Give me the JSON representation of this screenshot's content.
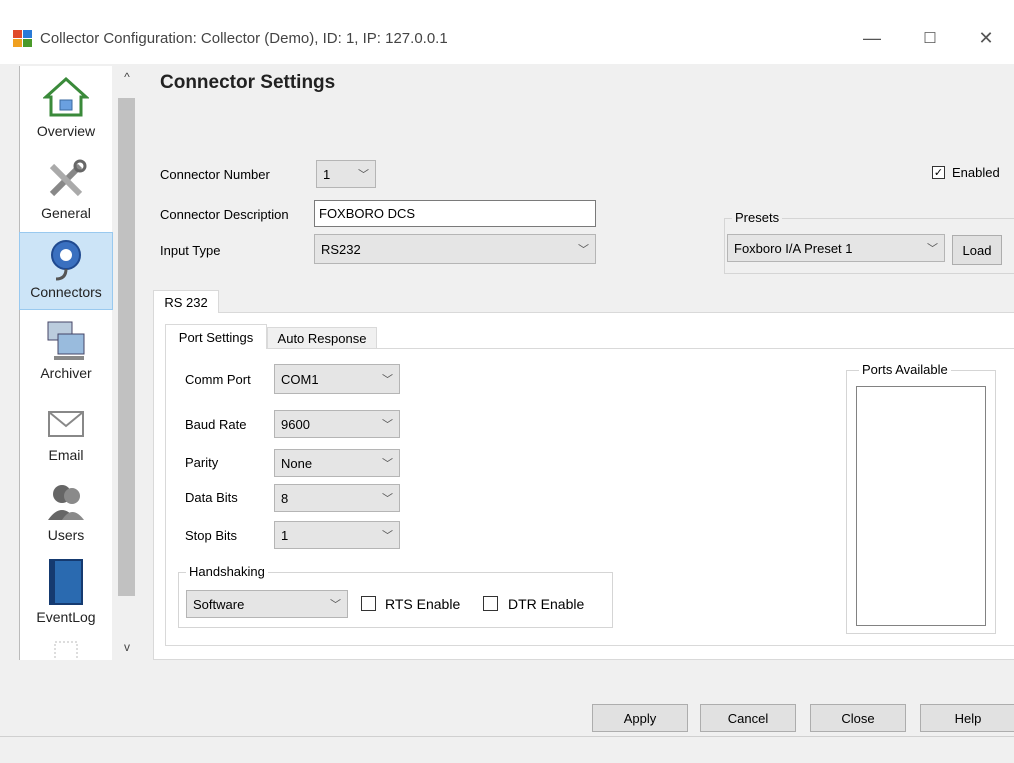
{
  "window": {
    "title": "Collector Configuration: Collector (Demo), ID: 1, IP: 127.0.0.1",
    "minimize": "—",
    "maximize": "☐",
    "close": "✕"
  },
  "nav": {
    "items": [
      {
        "label": "Overview"
      },
      {
        "label": "General"
      },
      {
        "label": "Connectors"
      },
      {
        "label": "Archiver"
      },
      {
        "label": "Email"
      },
      {
        "label": "Users"
      },
      {
        "label": "EventLog"
      }
    ],
    "scroll_up": "^",
    "scroll_down": "v"
  },
  "page_title": "Connector Settings",
  "connector": {
    "number_label": "Connector Number",
    "number_value": "1",
    "description_label": "Connector Description",
    "description_value": "FOXBORO DCS",
    "input_type_label": "Input Type",
    "input_type_value": "RS232",
    "enabled_label": "Enabled",
    "enabled_checked": true
  },
  "presets": {
    "legend": "Presets",
    "value": "Foxboro I/A Preset 1",
    "load_label": "Load"
  },
  "outer_tab": {
    "label": "RS 232"
  },
  "inner_tabs": [
    {
      "label": "Port Settings",
      "active": true
    },
    {
      "label": "Auto Response",
      "active": false
    }
  ],
  "port": {
    "comm_port_label": "Comm Port",
    "comm_port_value": "COM1",
    "baud_label": "Baud Rate",
    "baud_value": "9600",
    "parity_label": "Parity",
    "parity_value": "None",
    "data_bits_label": "Data Bits",
    "data_bits_value": "8",
    "stop_bits_label": "Stop Bits",
    "stop_bits_value": "1"
  },
  "handshaking": {
    "legend": "Handshaking",
    "value": "Software",
    "rts_label": "RTS Enable",
    "dtr_label": "DTR Enable"
  },
  "ports_available": {
    "legend": "Ports Available"
  },
  "buttons": {
    "apply": "Apply",
    "cancel": "Cancel",
    "close": "Close",
    "help": "Help"
  },
  "colors": {
    "selection": "#cce4f7",
    "accent": "#0078d7"
  }
}
